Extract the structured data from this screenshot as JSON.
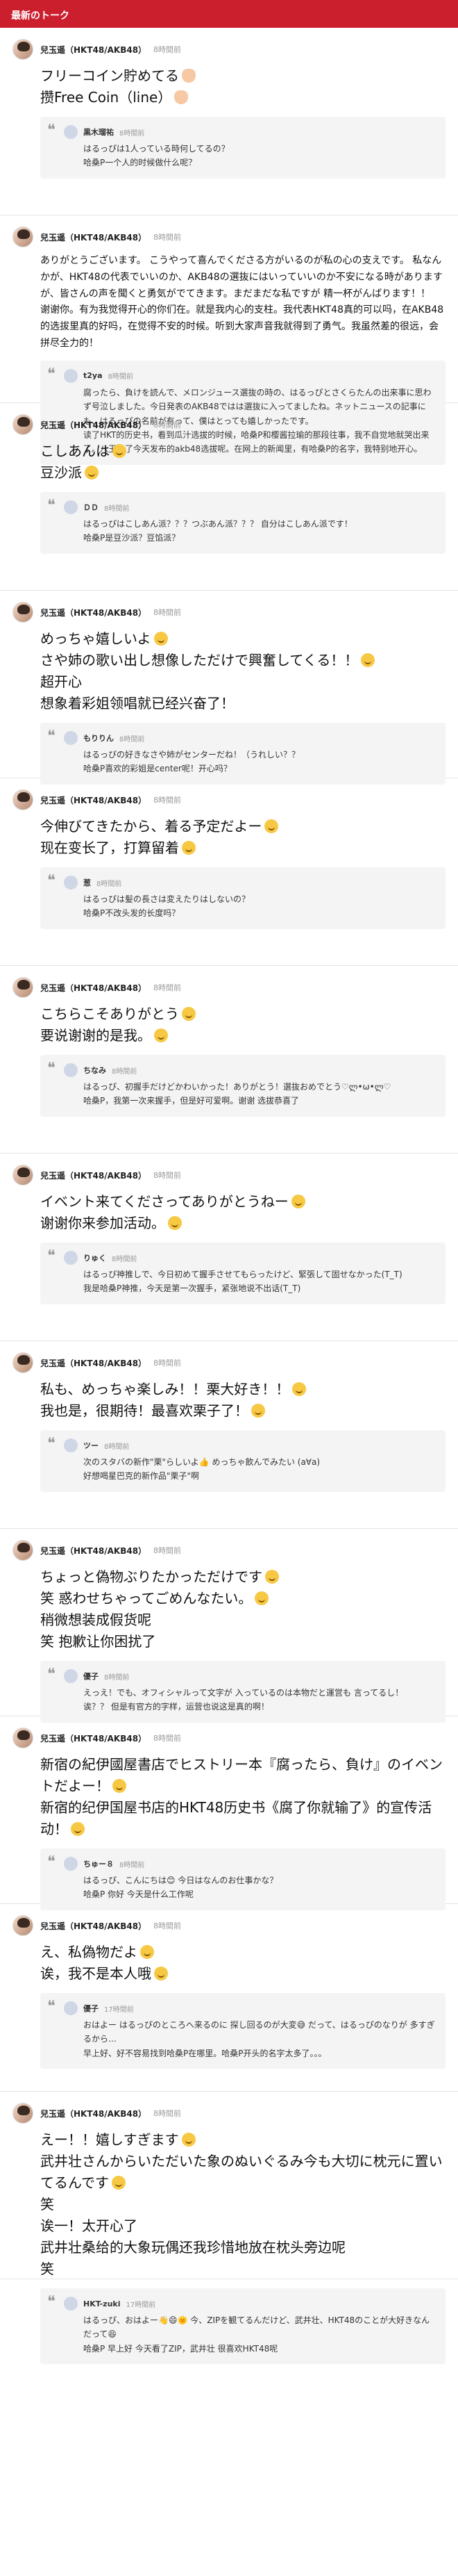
{
  "header": {
    "title": "最新のトーク"
  },
  "posts": [
    {
      "author": "兒玉遥（HKT48/AKB48）",
      "time": "8時間前",
      "lines": [
        "フリーコイン貯めてる",
        "攒Free Coin（line）"
      ],
      "reply": {
        "name": "黒木瑠祐",
        "time": "8時間前",
        "lines": [
          "はるっぴは1人っている時何してるの？",
          "哈桑P一个人的时候做什么呢？"
        ]
      }
    },
    {
      "author": "兒玉遥（HKT48/AKB48）",
      "time": "8時間前",
      "lines": [
        "ありがとうございます。 こうやって喜んでくださる方がいるのが私の心の支えです。 私なんかが、HKT48の代表でいいのか、AKB48の選抜にはいっていいのか不安になる時がありますが、皆さんの声を聞くと勇気がでてきます。まだまだな私ですが 精一杯がんばります！！",
        "谢谢你。有为我觉得开心的你们在。就是我内心的支柱。我代表HKT48真的可以吗，在AKB48的选拔里真的好吗，在觉得不安的时候。听到大家声音我就得到了勇气。我虽然差的很远，会拼尽全力的！"
      ],
      "reply": {
        "name": "t2ya",
        "time": "8時間前",
        "lines": [
          "腐ったら、負けを読んで、メロンジュース選抜の時の、はるっぴとさくらたんの出来事に思わず号泣しました。今日発表のAKB48ではは選抜に入ってましたね。ネットニュースの記事にも、はるっぴの名前が有って、僕はとっても嬉しかったです。",
          "读了HKT的历史书，看到瓜汁选拔的时候，哈桑P和樱酱拉瑜的那段往事，我不自觉地就哭出来了。八玉迪了今天发布的akb48选拔呢。在网上的新闻里，有哈桑P的名字，我特别地开心。"
        ]
      }
    },
    {
      "author": "兒玉遥（HKT48/AKB48）",
      "time": "8時間前",
      "lines": [
        "こしあんは",
        "豆沙派"
      ],
      "reply": {
        "name": "ＤＤ",
        "time": "8時間前",
        "lines": [
          "はるっぴはこしあん派？？？つぶあん派？？？ 自分はこしあん派です！",
          "哈桑P是豆沙派？豆馅派？"
        ]
      }
    },
    {
      "author": "兒玉遥（HKT48/AKB48）",
      "time": "8時間前",
      "lines": [
        "めっちゃ嬉しいよ",
        "さや姉の歌い出し想像しただけで興奮してくる！！",
        "超开心",
        "想象着彩姐领唱就已经兴奋了！"
      ],
      "reply": {
        "name": "もりりん",
        "time": "8時間前",
        "lines": [
          "はるっぴの好きなさや姉がセンターだね！（うれしい？？",
          "哈桑P喜欢的彩姐是center呢！开心吗？"
        ]
      }
    },
    {
      "author": "兒玉遥（HKT48/AKB48）",
      "time": "8時間前",
      "lines": [
        "今伸びてきたから、着る予定だよー",
        "现在变长了，打算留着"
      ],
      "reply": {
        "name": "葱",
        "time": "8時間前",
        "lines": [
          "はるっぴは髪の長さは変えたりはしないの？",
          "哈桑P不改头发的长度吗？"
        ]
      }
    },
    {
      "author": "兒玉遥（HKT48/AKB48）",
      "time": "8時間前",
      "lines": [
        "こちらこそありがとう",
        "要说谢谢的是我。"
      ],
      "reply": {
        "name": "ちなみ",
        "time": "8時間前",
        "lines": [
          "はるっぴ、初握手だけどかわいかった！ありがとう！選抜おめでとう♡ლ•ω•ლ♡",
          "哈桑P，我第一次来握手，但是好可爱啊。谢谢 选拔恭喜了"
        ]
      }
    },
    {
      "author": "兒玉遥（HKT48/AKB48）",
      "time": "8時間前",
      "lines": [
        "イベント来てくださってありがとうねー",
        "谢谢你来参加活动。"
      ],
      "reply": {
        "name": "りゅく",
        "time": "8時間前",
        "lines": [
          "はるっぴ神推しで、今日初めて握手させてもらったけど、緊張して固せなかった(T_T)",
          "我是哈桑P神推，今天是第一次握手，紧张地说不出话(T_T)"
        ]
      }
    },
    {
      "author": "兒玉遥（HKT48/AKB48）",
      "time": "8時間前",
      "lines": [
        "私も、めっちゃ楽しみ！！栗大好き！！",
        "我也是，很期待！最喜欢栗子了！"
      ],
      "reply": {
        "name": "ツー",
        "time": "8時間前",
        "lines": [
          "次のスタバの新作\"栗\"らしいよ👍 めっちゃ飲んでみたい (a∀a)",
          "好想喝星巴克的新作品\"栗子\"啊"
        ]
      }
    },
    {
      "author": "兒玉遥（HKT48/AKB48）",
      "time": "8時間前",
      "lines": [
        "ちょっと偽物ぶりたかっただけです",
        "笑 惑わせちゃってごめんなたい。",
        "稍微想装成假货呢",
        "笑 抱歉让你困扰了"
      ],
      "reply": {
        "name": "優子",
        "time": "8時間前",
        "lines": [
          "えっえ！でも、オフィシャルって文字が 入っているのは本物だと運営も 言ってるし！",
          "诶？？ 但是有官方的字样，运营也说这是真的啊！"
        ]
      }
    },
    {
      "author": "兒玉遥（HKT48/AKB48）",
      "time": "8時間前",
      "lines": [
        "新宿の紀伊國屋書店でヒストリー本『腐ったら、負け』のイベントだよー！",
        "新宿的纪伊国屋书店的HKT48历史书《腐了你就输了》的宣传活动！"
      ],
      "reply": {
        "name": "ちゅー８",
        "time": "8時間前",
        "lines": [
          "はるっぴ、こんにちは😊 今日はなんのお仕事かな？",
          "哈桑P 你好 今天是什么工作呢"
        ]
      }
    },
    {
      "author": "兒玉遥（HKT48/AKB48）",
      "time": "8時間前",
      "lines": [
        "え、私偽物だよ",
        "诶，我不是本人哦"
      ],
      "reply": {
        "name": "優子",
        "time": "17時間前",
        "lines": [
          "おはよー はるっぴのところへ来るのに 探し回るのが大変😅 だって、はるっぴのなりが 多すぎるから…",
          "早上好、好不容易找到哈桑P在哪里。哈桑P开头的名字太多了。。。"
        ]
      }
    },
    {
      "author": "兒玉遥（HKT48/AKB48）",
      "time": "8時間前",
      "lines": [
        "えー！！嬉しすぎます",
        "武井壮さんからいただいた象のぬいぐるみ今も大切に枕元に置いてるんです",
        "笑",
        "诶一！太开心了",
        "武井壮桑给的大象玩偶还我珍惜地放在枕头旁边呢",
        "笑"
      ],
      "reply": {
        "name": "HKT-zuki",
        "time": "17時間前",
        "lines": [
          "はるっぴ、おはよー👋😄🌞 今、ZIPを観てるんだけど、武井壮、HKT48のことが大好きなんだって😆",
          "哈桑P 早上好 今天看了ZIP，武井壮 很喜欢HKT48呢"
        ]
      }
    }
  ]
}
